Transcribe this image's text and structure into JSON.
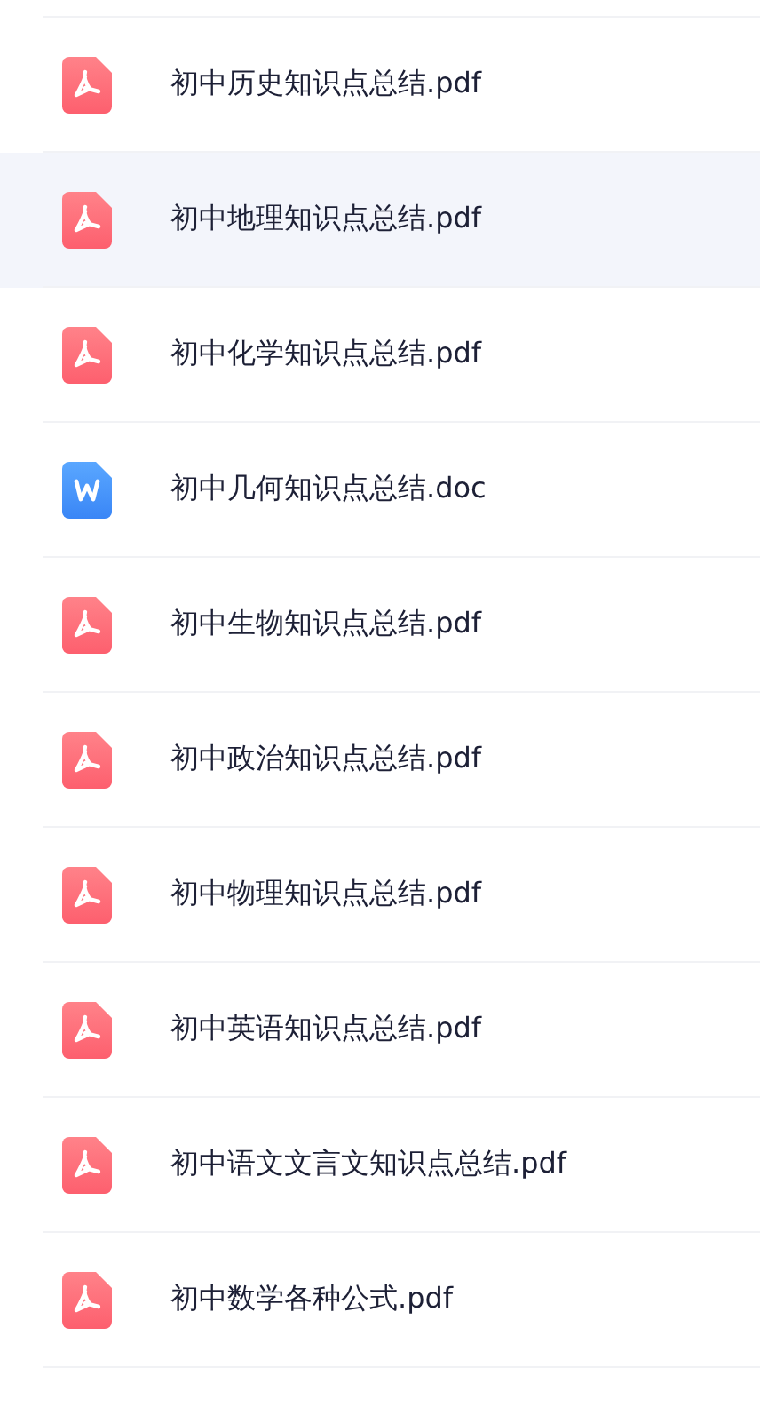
{
  "files": [
    {
      "name": "初中历史知识点总结.pdf",
      "kind": "pdf",
      "selected": false
    },
    {
      "name": "初中地理知识点总结.pdf",
      "kind": "pdf",
      "selected": true
    },
    {
      "name": "初中化学知识点总结.pdf",
      "kind": "pdf",
      "selected": false
    },
    {
      "name": "初中几何知识点总结.doc",
      "kind": "doc",
      "selected": false
    },
    {
      "name": "初中生物知识点总结.pdf",
      "kind": "pdf",
      "selected": false
    },
    {
      "name": "初中政治知识点总结.pdf",
      "kind": "pdf",
      "selected": false
    },
    {
      "name": "初中物理知识点总结.pdf",
      "kind": "pdf",
      "selected": false
    },
    {
      "name": "初中英语知识点总结.pdf",
      "kind": "pdf",
      "selected": false
    },
    {
      "name": "初中语文文言文知识点总结.pdf",
      "kind": "pdf",
      "selected": false
    },
    {
      "name": "初中数学各种公式.pdf",
      "kind": "pdf",
      "selected": false
    }
  ]
}
